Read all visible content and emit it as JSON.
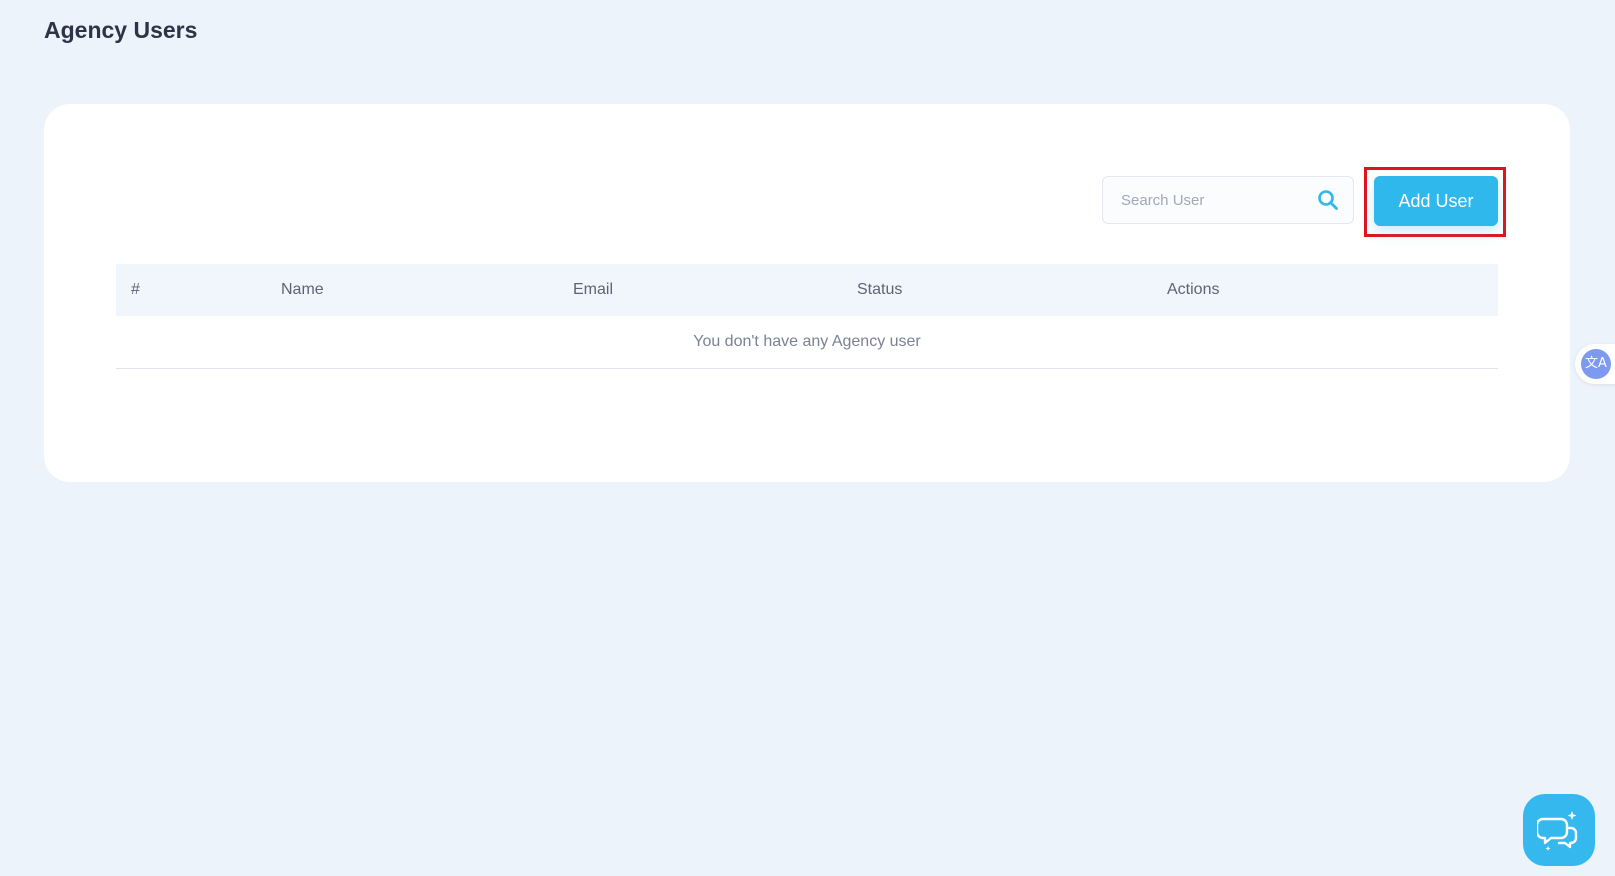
{
  "page": {
    "title": "Agency Users"
  },
  "toolbar": {
    "search_placeholder": "Search User",
    "add_user_label": "Add User"
  },
  "table": {
    "columns": [
      "#",
      "Name",
      "Email",
      "Status",
      "Actions"
    ],
    "empty_message": "You don't have any Agency user"
  },
  "widgets": {
    "translate_icon": "translate-icon",
    "translate_glyph": "文A",
    "chat_icon": "chat-bubbles-sparkle-icon"
  },
  "colors": {
    "background": "#edf3fa",
    "accent": "#2fb8ec",
    "highlight": "#e0141f"
  }
}
